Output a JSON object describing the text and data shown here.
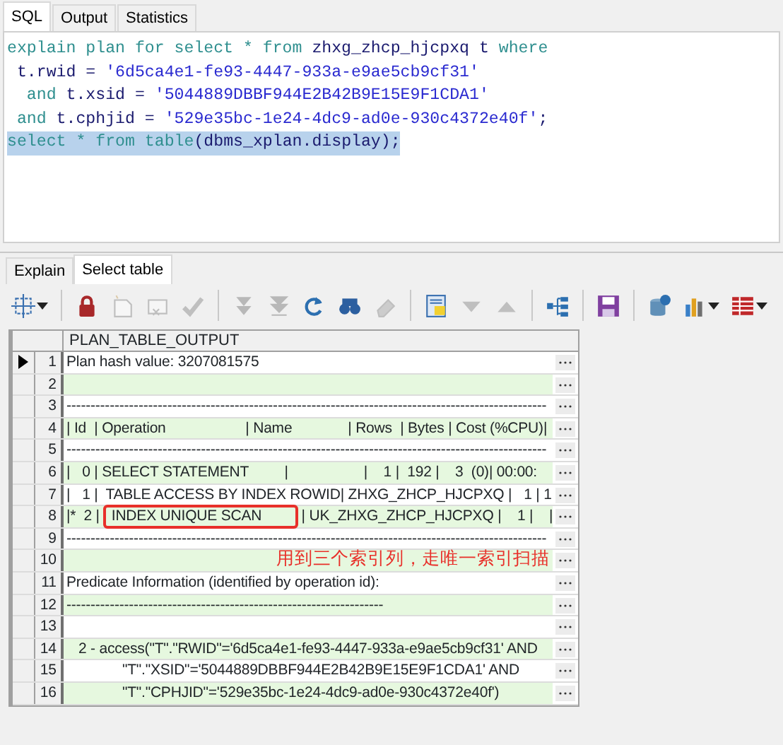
{
  "editor_tabs": [
    {
      "label": "SQL",
      "selected": true
    },
    {
      "label": "Output",
      "selected": false
    },
    {
      "label": "Statistics",
      "selected": false
    }
  ],
  "sql_lines": [
    {
      "selected": false,
      "tokens": [
        {
          "kind": "keyword",
          "text": "explain plan for select * from "
        },
        {
          "kind": "ident",
          "text": "zhxg_zhcp_hjcpxq t "
        },
        {
          "kind": "keyword",
          "text": "where"
        }
      ]
    },
    {
      "selected": false,
      "tokens": [
        {
          "kind": "ident",
          "text": " t.rwid = "
        },
        {
          "kind": "string",
          "text": "'6d5ca4e1-fe93-4447-933a-e9ae5cb9cf31'"
        }
      ]
    },
    {
      "selected": false,
      "tokens": [
        {
          "kind": "keyword",
          "text": "  and "
        },
        {
          "kind": "ident",
          "text": "t.xsid = "
        },
        {
          "kind": "string",
          "text": "'5044889DBBF944E2B42B9E15E9F1CDA1'"
        }
      ]
    },
    {
      "selected": false,
      "tokens": [
        {
          "kind": "keyword",
          "text": " and "
        },
        {
          "kind": "ident",
          "text": "t.cphjid = "
        },
        {
          "kind": "string",
          "text": "'529e35bc-1e24-4dc9-ad0e-930c4372e40f'"
        },
        {
          "kind": "ident",
          "text": ";"
        }
      ]
    },
    {
      "selected": true,
      "tokens": [
        {
          "kind": "keyword",
          "text": "select * from table"
        },
        {
          "kind": "ident",
          "text": "(dbms_xplan.display);"
        }
      ]
    }
  ],
  "result_tabs": [
    {
      "label": "Explain",
      "selected": false
    },
    {
      "label": "Select table",
      "selected": true
    }
  ],
  "toolbar": [
    {
      "kind": "select-area",
      "disabled": false,
      "dropdown": true
    },
    {
      "kind": "separator"
    },
    {
      "kind": "lock",
      "disabled": false
    },
    {
      "kind": "new-record",
      "disabled": true
    },
    {
      "kind": "delete-record",
      "disabled": true
    },
    {
      "kind": "check",
      "disabled": true
    },
    {
      "kind": "separator"
    },
    {
      "kind": "fetch-next",
      "disabled": true
    },
    {
      "kind": "fetch-last",
      "disabled": true
    },
    {
      "kind": "refresh",
      "disabled": false
    },
    {
      "kind": "find",
      "disabled": false
    },
    {
      "kind": "clear",
      "disabled": true
    },
    {
      "kind": "separator"
    },
    {
      "kind": "query-form",
      "disabled": false
    },
    {
      "kind": "triangle-down",
      "disabled": true
    },
    {
      "kind": "triangle-up",
      "disabled": true
    },
    {
      "kind": "separator"
    },
    {
      "kind": "tree",
      "disabled": false
    },
    {
      "kind": "separator"
    },
    {
      "kind": "save",
      "disabled": false
    },
    {
      "kind": "separator"
    },
    {
      "kind": "export",
      "disabled": false
    },
    {
      "kind": "chart",
      "disabled": false,
      "dropdown": true
    },
    {
      "kind": "grid",
      "disabled": false,
      "dropdown": true
    }
  ],
  "grid": {
    "column": "PLAN_TABLE_OUTPUT",
    "rows": [
      {
        "num": "1",
        "selected": true,
        "value": "Plan hash value: 3207081575"
      },
      {
        "num": "2",
        "selected": false,
        "value": ""
      },
      {
        "num": "3",
        "selected": false,
        "value": "----------------------------------------------------------------------------------------------------"
      },
      {
        "num": "4",
        "selected": false,
        "value": "| Id  | Operation                    | Name              | Rows  | Bytes | Cost (%CPU)|"
      },
      {
        "num": "5",
        "selected": false,
        "value": "----------------------------------------------------------------------------------------------------"
      },
      {
        "num": "6",
        "selected": false,
        "value": "|   0 | SELECT STATEMENT         |                   |    1 |  192 |    3  (0)| 00:00:"
      },
      {
        "num": "7",
        "selected": false,
        "value": "|   1 |  TABLE ACCESS BY INDEX ROWID| ZHXG_ZHCP_HJCPXQ |   1 | 1"
      },
      {
        "num": "8",
        "selected": false,
        "boxed": true,
        "value": "|*  2 |   INDEX UNIQUE SCAN          | UK_ZHXG_ZHCP_HJCPXQ |    1 |    |"
      },
      {
        "num": "9",
        "selected": false,
        "value": "----------------------------------------------------------------------------------------------------"
      },
      {
        "num": "10",
        "selected": false,
        "value": "",
        "note": "用到三个索引列，走唯一索引扫描"
      },
      {
        "num": "11",
        "selected": false,
        "value": "Predicate Information (identified by operation id):"
      },
      {
        "num": "12",
        "selected": false,
        "value": "------------------------------------------------------------------"
      },
      {
        "num": "13",
        "selected": false,
        "value": ""
      },
      {
        "num": "14",
        "selected": false,
        "value": "   2 - access(\"T\".\"RWID\"='6d5ca4e1-fe93-4447-933a-e9ae5cb9cf31' AND"
      },
      {
        "num": "15",
        "selected": false,
        "value": "              \"T\".\"XSID\"='5044889DBBF944E2B42B9E15E9F1CDA1' AND"
      },
      {
        "num": "16",
        "selected": false,
        "value": "              \"T\".\"CPHJID\"='529e35bc-1e24-4dc9-ad0e-930c4372e40f')"
      }
    ]
  }
}
